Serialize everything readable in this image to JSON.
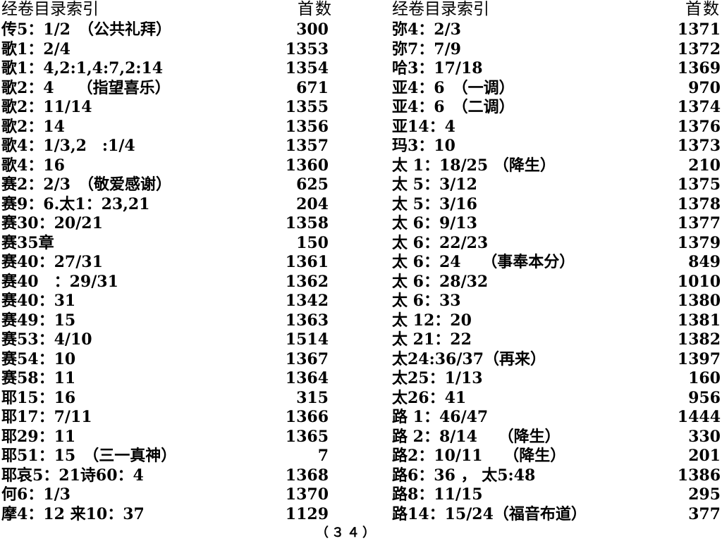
{
  "headers": {
    "left": {
      "title": "经卷目录索引",
      "count": "首数"
    },
    "right": {
      "title": "经卷目录索引",
      "count": "首数"
    }
  },
  "left_rows": [
    {
      "ref": "传5：1/2　（公共礼拜）",
      "hymn": "300"
    },
    {
      "ref": "歌1：2/4",
      "hymn": "1353"
    },
    {
      "ref": "歌1：4,2:1,4:7,2:14",
      "hymn": "1354"
    },
    {
      "ref": "歌2：4　　（指望喜乐）",
      "hymn": "671"
    },
    {
      "ref": "歌2：11/14",
      "hymn": "1355"
    },
    {
      "ref": "歌2：14",
      "hymn": "1356"
    },
    {
      "ref": "歌4：1/3,2　:1/4",
      "hymn": "1357"
    },
    {
      "ref": "歌4：16",
      "hymn": "1360"
    },
    {
      "ref": "赛2：2/3　（敬爱感谢）",
      "hymn": "625"
    },
    {
      "ref": "赛9：6.太1：23,21",
      "hymn": "204"
    },
    {
      "ref": "赛30：20/21",
      "hymn": "1358"
    },
    {
      "ref": "赛35章",
      "hymn": "150"
    },
    {
      "ref": "赛40：27/31",
      "hymn": "1361"
    },
    {
      "ref": "赛40　：29/31",
      "hymn": "1362"
    },
    {
      "ref": "赛40：31",
      "hymn": "1342"
    },
    {
      "ref": "赛49：15",
      "hymn": "1363"
    },
    {
      "ref": "赛53：4/10",
      "hymn": "1514"
    },
    {
      "ref": "赛54：10",
      "hymn": "1367"
    },
    {
      "ref": "赛58：11",
      "hymn": "1364"
    },
    {
      "ref": "耶15：16",
      "hymn": "315"
    },
    {
      "ref": "耶17：7/11",
      "hymn": "1366"
    },
    {
      "ref": "耶29：11",
      "hymn": "1365"
    },
    {
      "ref": "耶51：15　（三一真神）",
      "hymn": "7"
    },
    {
      "ref": "耶哀5：21诗60：4",
      "hymn": "1368"
    },
    {
      "ref": "何6：1/3",
      "hymn": "1370"
    },
    {
      "ref": "摩4：12 来10：37",
      "hymn": "1129"
    }
  ],
  "right_rows": [
    {
      "ref": "弥4：2/3",
      "hymn": "1371"
    },
    {
      "ref": "弥7：7/9",
      "hymn": "1372"
    },
    {
      "ref": "哈3：17/18",
      "hymn": "1369"
    },
    {
      "ref": "亚4：6　（一调）",
      "hymn": "970"
    },
    {
      "ref": "亚4：6　（二调）",
      "hymn": "1374"
    },
    {
      "ref": "亚14：4",
      "hymn": "1376"
    },
    {
      "ref": "玛3：10",
      "hymn": "1373"
    },
    {
      "ref": "太 1：18/25 （降生）",
      "hymn": "210"
    },
    {
      "ref": "太 5：3/12",
      "hymn": "1375"
    },
    {
      "ref": "太 5：3/16",
      "hymn": "1378"
    },
    {
      "ref": "太 6：9/13",
      "hymn": "1377"
    },
    {
      "ref": "太 6：22/23",
      "hymn": "1379"
    },
    {
      "ref": "太 6：24　 （事奉本分）",
      "hymn": "849"
    },
    {
      "ref": "太 6：28/32",
      "hymn": "1010"
    },
    {
      "ref": "太 6：33",
      "hymn": "1380"
    },
    {
      "ref": "太 12：20",
      "hymn": "1381"
    },
    {
      "ref": "太 21：22",
      "hymn": "1382"
    },
    {
      "ref": "太24:36/37（再来）",
      "hymn": "1397"
    },
    {
      "ref": "太25：1/13",
      "hymn": "160"
    },
    {
      "ref": "太26：41",
      "hymn": "956"
    },
    {
      "ref": "路 1：46/47",
      "hymn": "1444"
    },
    {
      "ref": "路 2：8/14　 （降生）",
      "hymn": "330"
    },
    {
      "ref": "路2：10/11　 （降生）",
      "hymn": "201"
    },
    {
      "ref": "路6：36 ， 太5:48",
      "hymn": "1386"
    },
    {
      "ref": "路8：11/15",
      "hymn": "295"
    },
    {
      "ref": "路14：15/24（福音布道）",
      "hymn": "377"
    }
  ],
  "footer": {
    "page_number": "（３４）"
  }
}
